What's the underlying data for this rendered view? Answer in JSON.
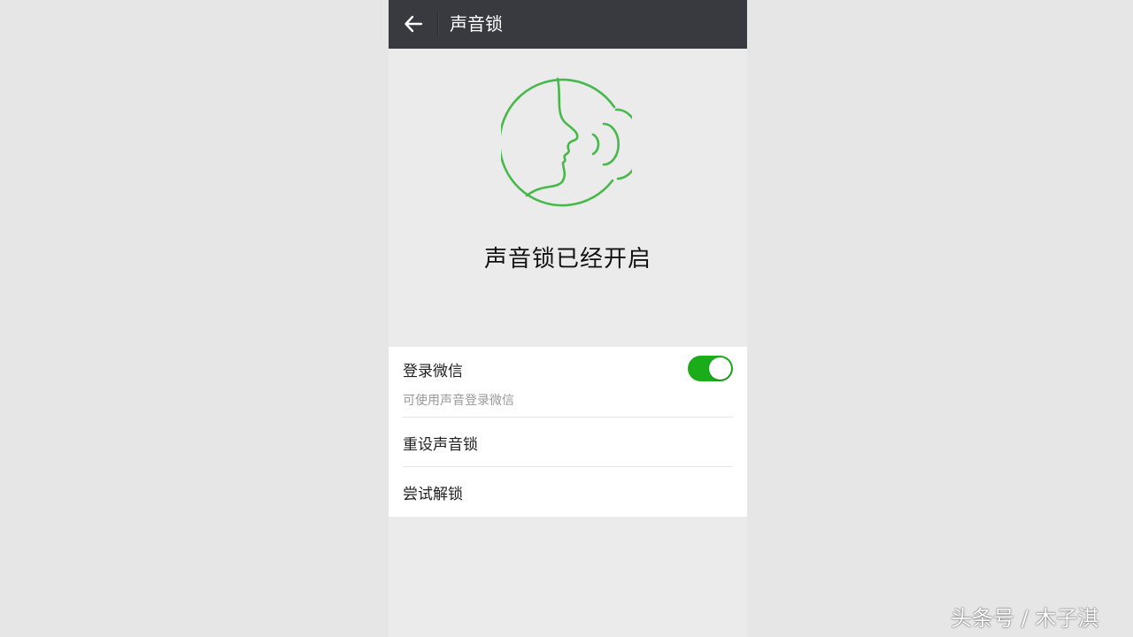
{
  "header": {
    "title": "声音锁",
    "back_icon": "arrow-left-icon"
  },
  "hero": {
    "icon": "voice-face-icon",
    "status_text": "声音锁已经开启"
  },
  "settings": {
    "voice_login": {
      "label": "登录微信",
      "description": "可使用声音登录微信",
      "enabled": true
    },
    "reset_label": "重设声音锁",
    "try_unlock_label": "尝试解锁"
  },
  "watermark": "头条号 / 木子淇",
  "colors": {
    "accent_green": "#1aad19",
    "icon_green": "#46b94a",
    "topbar": "#393a3f"
  }
}
